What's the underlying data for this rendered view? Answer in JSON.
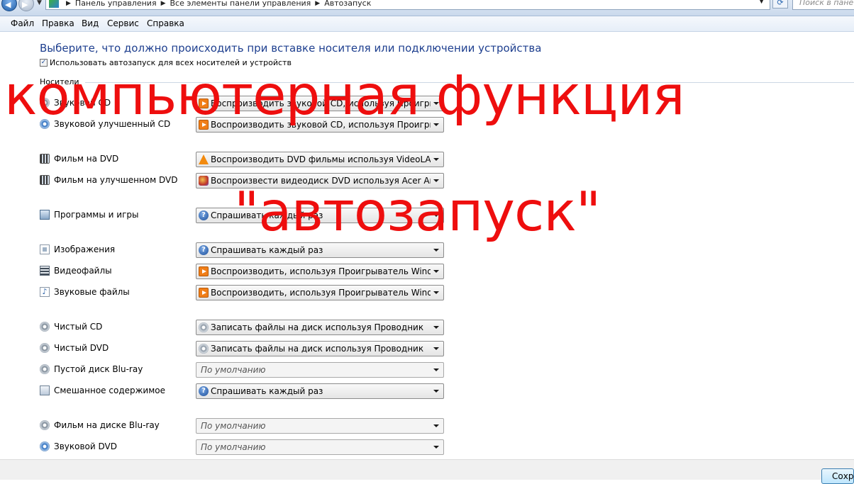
{
  "address_bar": {
    "breadcrumbs": [
      "Панель управления",
      "Все элементы панели управления",
      "Автозапуск"
    ],
    "search_placeholder": "Поиск в пане"
  },
  "menu": [
    "Файл",
    "Правка",
    "Вид",
    "Сервис",
    "Справка"
  ],
  "main": {
    "heading": "Выберите, что должно происходить при вставке носителя или подключении устройства",
    "autoplay_checkbox_label": "Использовать автозапуск для всех носителей и устройств",
    "autoplay_checked": true,
    "section_label": "Носители",
    "rows": [
      {
        "label": "Звуковой CD",
        "icon": "cd-audio-icon",
        "action": "Воспроизводить звуковой CD, используя Проигрывате",
        "action_icon": "media-player-icon"
      },
      {
        "label": "Звуковой улучшенный CD",
        "icon": "enhanced-cd-icon",
        "action": "Воспроизводить звуковой CD, используя Проигрывател",
        "action_icon": "media-player-icon"
      },
      {
        "label": "Фильм на DVD",
        "icon": "dvd-movie-icon",
        "action": "Воспроизводить DVD фильмы используя VideoLAN VLC",
        "action_icon": "vlc-icon"
      },
      {
        "label": "Фильм на улучшенном DVD",
        "icon": "enhanced-dvd-icon",
        "action": "Воспроизвести видеодиск DVD используя Acer Arcade D",
        "action_icon": "acer-arcade-icon"
      },
      {
        "label": "Программы и игры",
        "icon": "programs-icon",
        "action": "Спрашивать каждый раз",
        "action_icon": "ask-icon"
      },
      {
        "label": "Изображения",
        "icon": "pictures-icon",
        "action": "Спрашивать каждый раз",
        "action_icon": "ask-icon"
      },
      {
        "label": "Видеофайлы",
        "icon": "video-files-icon",
        "action": "Воспроизводить, используя Проигрыватель Windows M",
        "action_icon": "media-player-icon"
      },
      {
        "label": "Звуковые файлы",
        "icon": "audio-files-icon",
        "action": "Воспроизводить, используя Проигрыватель Windows M",
        "action_icon": "media-player-icon"
      },
      {
        "label": "Чистый CD",
        "icon": "blank-cd-icon",
        "action": "Записать файлы на диск используя Проводник",
        "action_icon": "burn-disc-icon"
      },
      {
        "label": "Чистый DVD",
        "icon": "blank-dvd-icon",
        "action": "Записать файлы на диск используя Проводник",
        "action_icon": "burn-disc-icon"
      },
      {
        "label": "Пустой диск Blu-ray",
        "icon": "blank-bluray-icon",
        "action": "По умолчанию",
        "action_icon": ""
      },
      {
        "label": "Смешанное содержимое",
        "icon": "mixed-content-icon",
        "action": "Спрашивать каждый раз",
        "action_icon": "ask-icon"
      },
      {
        "label": "Фильм на диске Blu-ray",
        "icon": "bluray-movie-icon",
        "action": "По умолчанию",
        "action_icon": ""
      },
      {
        "label": "Звуковой DVD",
        "icon": "dvd-audio-icon",
        "action": "По умолчанию",
        "action_icon": ""
      }
    ]
  },
  "overlay": {
    "line1": "компьютерная функция",
    "line2": "\"автозапуск\""
  },
  "footer": {
    "save_label": "Сохра"
  },
  "colors": {
    "heading": "#1e3f8f",
    "overlay": "#ee0e0e"
  }
}
